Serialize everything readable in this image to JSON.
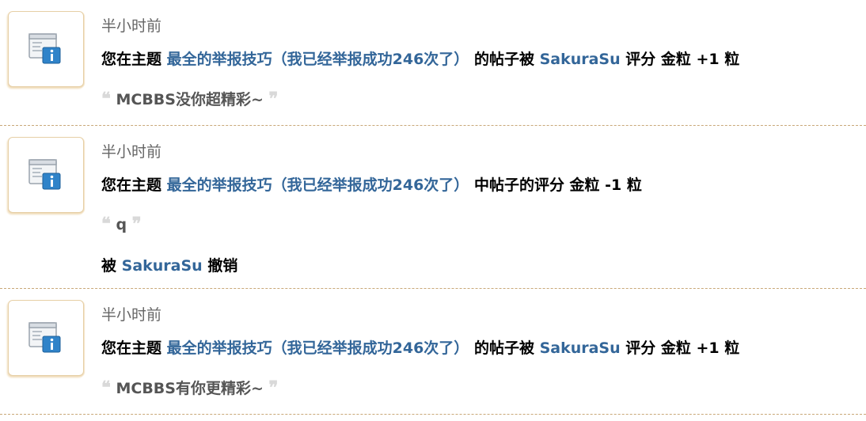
{
  "notices": [
    {
      "time": "半小时前",
      "prefix": "您在主题",
      "thread_title": "最全的举报技巧（我已经举报成功246次了）",
      "middle": "的帖子被",
      "user": "SakuraSu",
      "action": "评分 金粒 +1 粒",
      "quote": "MCBBS没你超精彩~"
    },
    {
      "time": "半小时前",
      "prefix": "您在主题",
      "thread_title": "最全的举报技巧（我已经举报成功246次了）",
      "action": "中帖子的评分 金粒 -1 粒",
      "quote": "q",
      "revoke_prefix": "被",
      "revoke_user": "SakuraSu",
      "revoke_action": "撤销"
    },
    {
      "time": "半小时前",
      "prefix": "您在主题",
      "thread_title": "最全的举报技巧（我已经举报成功246次了）",
      "middle": "的帖子被",
      "user": "SakuraSu",
      "action": "评分 金粒 +1 粒",
      "quote": "MCBBS有你更精彩~"
    }
  ],
  "quote_open": "❝",
  "quote_close": "❞",
  "icon": "system-notice-icon",
  "colors": {
    "link": "#336699",
    "divider": "#c9a878",
    "time": "#666666"
  }
}
